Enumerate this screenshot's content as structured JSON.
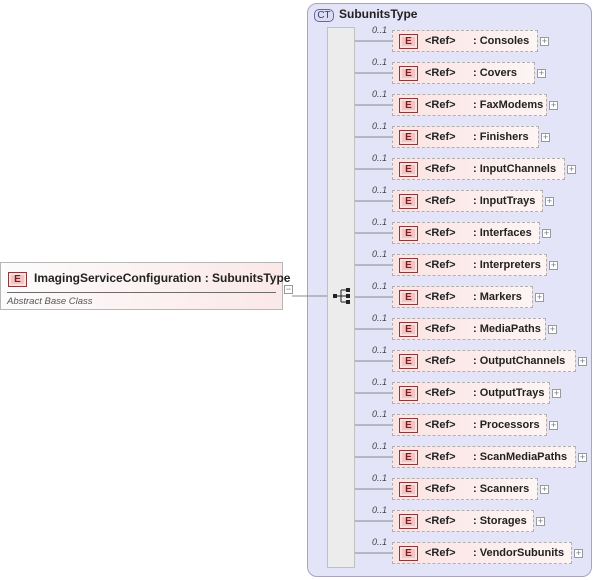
{
  "element": {
    "badge": "E",
    "title": "ImagingServiceConfiguration : SubunitsType",
    "documentation": "Abstract Base Class"
  },
  "complex_type": {
    "badge": "CT",
    "name": "SubunitsType"
  },
  "children": [
    {
      "cardinality": "0..1",
      "badge": "E",
      "ref": "<Ref>",
      "name": ": Consoles"
    },
    {
      "cardinality": "0..1",
      "badge": "E",
      "ref": "<Ref>",
      "name": ": Covers"
    },
    {
      "cardinality": "0..1",
      "badge": "E",
      "ref": "<Ref>",
      "name": ": FaxModems"
    },
    {
      "cardinality": "0..1",
      "badge": "E",
      "ref": "<Ref>",
      "name": ": Finishers"
    },
    {
      "cardinality": "0..1",
      "badge": "E",
      "ref": "<Ref>",
      "name": ": InputChannels"
    },
    {
      "cardinality": "0..1",
      "badge": "E",
      "ref": "<Ref>",
      "name": ": InputTrays"
    },
    {
      "cardinality": "0..1",
      "badge": "E",
      "ref": "<Ref>",
      "name": ": Interfaces"
    },
    {
      "cardinality": "0..1",
      "badge": "E",
      "ref": "<Ref>",
      "name": ": Interpreters"
    },
    {
      "cardinality": "0..1",
      "badge": "E",
      "ref": "<Ref>",
      "name": ": Markers"
    },
    {
      "cardinality": "0..1",
      "badge": "E",
      "ref": "<Ref>",
      "name": ": MediaPaths"
    },
    {
      "cardinality": "0..1",
      "badge": "E",
      "ref": "<Ref>",
      "name": ": OutputChannels"
    },
    {
      "cardinality": "0..1",
      "badge": "E",
      "ref": "<Ref>",
      "name": ": OutputTrays"
    },
    {
      "cardinality": "0..1",
      "badge": "E",
      "ref": "<Ref>",
      "name": ": Processors"
    },
    {
      "cardinality": "0..1",
      "badge": "E",
      "ref": "<Ref>",
      "name": ": ScanMediaPaths"
    },
    {
      "cardinality": "0..1",
      "badge": "E",
      "ref": "<Ref>",
      "name": ": Scanners"
    },
    {
      "cardinality": "0..1",
      "badge": "E",
      "ref": "<Ref>",
      "name": ": Storages"
    },
    {
      "cardinality": "0..1",
      "badge": "E",
      "ref": "<Ref>",
      "name": ": VendorSubunits"
    }
  ]
}
